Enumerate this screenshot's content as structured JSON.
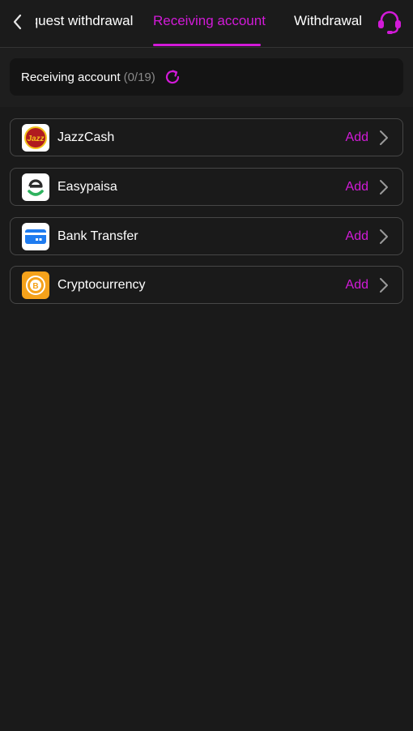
{
  "header": {
    "tabs": [
      {
        "label": "Request withdrawal"
      },
      {
        "label": "Receiving account"
      },
      {
        "label": "Withdrawal history"
      }
    ],
    "active_tab": 1
  },
  "summary": {
    "label": "Receiving account",
    "count": "(0/19)"
  },
  "methods": [
    {
      "name": "JazzCash",
      "action": "Add"
    },
    {
      "name": "Easypaisa",
      "action": "Add"
    },
    {
      "name": "Bank Transfer",
      "action": "Add"
    },
    {
      "name": "Cryptocurrency",
      "action": "Add"
    }
  ],
  "colors": {
    "accent": "#d21ad8",
    "background": "#1a1a1a",
    "border": "#474747"
  },
  "icons": [
    "back-arrow-icon",
    "headset-support-icon",
    "refresh-icon",
    "jazzcash-logo",
    "easypaisa-logo",
    "bank-card-icon",
    "bitcoin-coin-icon",
    "chevron-right-icon"
  ]
}
